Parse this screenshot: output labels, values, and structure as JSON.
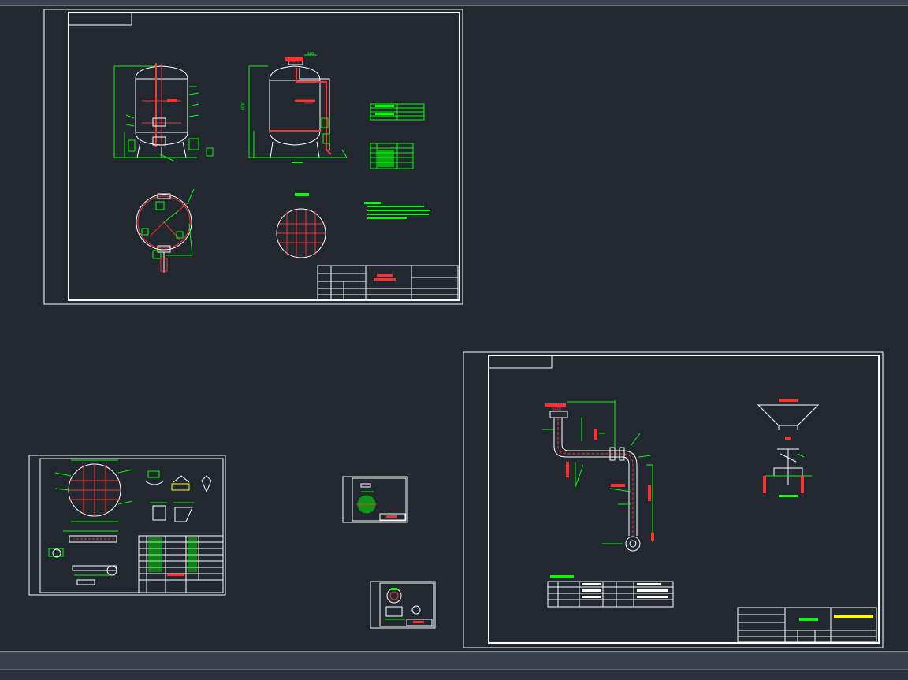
{
  "app": {
    "model_space_label": ""
  },
  "drawings": [
    {
      "id": "sheet-1",
      "labels": {
        "dia_tag": "Φ1200",
        "dim_top": "400",
        "dim_height": "4000",
        "dim_side": "1800"
      }
    },
    {
      "id": "sheet-2",
      "labels": {
        "dia_tag": "Φ400",
        "dim_a": "200",
        "dim_b": "1000",
        "dim_c": "2000"
      }
    },
    {
      "id": "sheet-3",
      "labels": {}
    },
    {
      "id": "sheet-4",
      "labels": {}
    },
    {
      "id": "sheet-5",
      "labels": {}
    }
  ],
  "colors": {
    "background": "#212830",
    "sheet_border": "#ffffff",
    "geometry_green": "#00ff00",
    "geometry_red": "#ff3030",
    "geometry_white": "#ffffff"
  },
  "icons": {
    "tank": "pressure-tank-icon",
    "pipe": "pipe-elbow-icon"
  }
}
